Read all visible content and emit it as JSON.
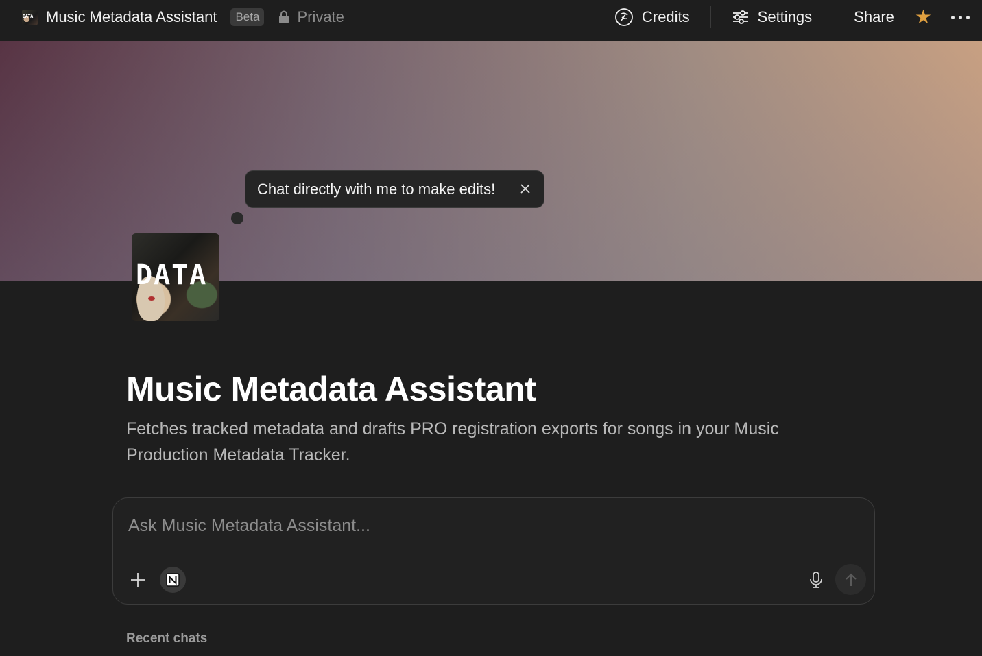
{
  "topbar": {
    "title": "Music Metadata Assistant",
    "badge": "Beta",
    "visibility": "Private",
    "credits_label": "Credits",
    "settings_label": "Settings",
    "share_label": "Share"
  },
  "tooltip": {
    "text": "Chat directly with me to make edits!"
  },
  "avatar": {
    "text": "DATA"
  },
  "main": {
    "title": "Music Metadata Assistant",
    "description": "Fetches tracked metadata and drafts PRO registration exports for songs in your Music Production Metadata Tracker."
  },
  "chat": {
    "placeholder": "Ask Music Metadata Assistant..."
  },
  "recent": {
    "label": "Recent chats"
  },
  "colors": {
    "star": "#e0a040",
    "background": "#1e1e1e"
  }
}
